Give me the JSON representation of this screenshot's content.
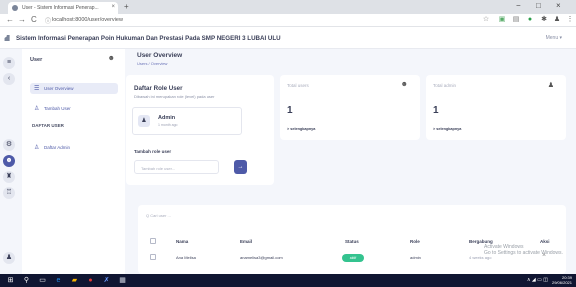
{
  "browser": {
    "tab_title": "User - Sistem Informasi Penerap...",
    "tab_close": "×",
    "new_tab": "+",
    "url": "localhost:8000/user/overview",
    "back": "←",
    "forward": "→",
    "reload": "C",
    "win_min": "−",
    "win_max": "□",
    "win_close": "×"
  },
  "header": {
    "title": "Sistem Informasi Penerapan Poin Hukuman Dan Prestasi Pada SMP NEGERI 3 LUBAI ULU",
    "menu_label": "Menu ▾"
  },
  "sidebar": {
    "user_label": "User",
    "items": [
      {
        "label": "User Overview",
        "icon": "list-icon"
      },
      {
        "label": "Tambah User",
        "icon": "user-plus-icon"
      }
    ],
    "section_heading": "DAFTAR USER",
    "admin_item": {
      "label": "Daftar Admin",
      "icon": "users-icon"
    }
  },
  "page": {
    "title": "User Overview",
    "breadcrumb": "Users  /  Overview"
  },
  "role_card": {
    "title": "Daftar Role User",
    "subtitle": "Dibawah ini merupakan role (level) pada user",
    "role_name": "Admin",
    "role_time": "1 month ago",
    "add_label": "Tambah role user",
    "add_placeholder": "Tambah role user...",
    "add_button": "→"
  },
  "stats": [
    {
      "title": "Total users",
      "value": "1",
      "link": "> selengkapnya"
    },
    {
      "title": "Total admin",
      "value": "1",
      "link": "> selengkapnya"
    }
  ],
  "table": {
    "search_placeholder": "Q  Cari user ...",
    "headers": [
      "Nama",
      "Email",
      "Status",
      "Role",
      "Bergabung",
      "Aksi"
    ],
    "rows": [
      {
        "nama": "Ana Melisa",
        "email": "anamelisa3@gmail.com",
        "status": "aktif",
        "role": "admin",
        "bergabung": "4 weeks ago",
        "aksi": "×"
      }
    ]
  },
  "watermark": {
    "line1": "Activate Windows",
    "line2": "Go to Settings to activate Windows."
  },
  "taskbar": {
    "time": "20:39",
    "date": "29/06/2021",
    "tray": "∧ ◢ ▭ ◫"
  },
  "colors": {
    "accent": "#4e5aa8",
    "status_active": "#34c38f",
    "taskbar": "#101632"
  }
}
